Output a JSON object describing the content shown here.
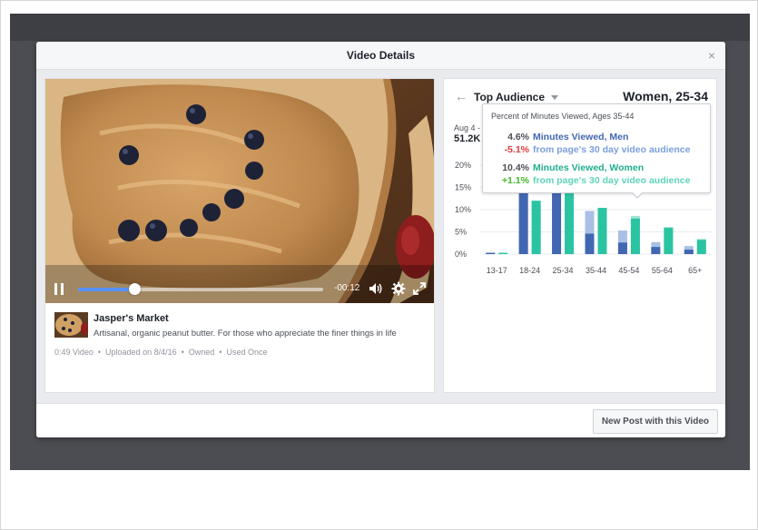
{
  "modal": {
    "title": "Video Details",
    "close_glyph": "×",
    "footer_button": "New Post with this Video"
  },
  "video": {
    "time_remaining": "-00:12",
    "progress": 0.23
  },
  "page": {
    "name": "Jasper's Market",
    "description": "Artisanal, organic peanut butter. For those who appreciate the finer things in life",
    "meta": [
      "0:49 Video",
      "Uploaded on 8/4/16",
      "Owned",
      "Used Once"
    ]
  },
  "audience": {
    "title": "Top Audience",
    "segment": "Women, 25-34",
    "date_label": "Aug 4 -",
    "count": "51.2K"
  },
  "tooltip": {
    "heading": "Percent of Minutes Viewed, Ages 35-44",
    "men_value": "4.6%",
    "men_label": "Minutes Viewed, Men",
    "men_diff": "-5.1%",
    "men_diff_label": "from page's 30 day video audience",
    "women_value": "10.4%",
    "women_label": "Minutes Viewed, Women",
    "women_diff": "+1.1%",
    "women_diff_label": "from page's 30 day video audience"
  },
  "colors": {
    "men": "#4267b2",
    "men_light": "#a9bfe6",
    "women": "#2bc4a3",
    "women_light": "#9fe6d4",
    "negative": "#e0393e",
    "positive": "#42b72a"
  },
  "chart_data": {
    "type": "bar",
    "categories": [
      "13-17",
      "18-24",
      "25-34",
      "35-44",
      "45-54",
      "55-64",
      "65+"
    ],
    "y_ticks": [
      "0%",
      "5%",
      "10%",
      "15%",
      "20%"
    ],
    "ylim": [
      0,
      20
    ],
    "series": [
      {
        "name": "Minutes Viewed, Men",
        "page_baseline": [
          0.3,
          20,
          20,
          9.7,
          5.3,
          2.7,
          1.8
        ],
        "values": [
          0.3,
          20,
          20,
          4.6,
          2.6,
          1.6,
          1.0
        ]
      },
      {
        "name": "Minutes Viewed, Women",
        "page_baseline": [
          0.3,
          12,
          20,
          9.3,
          8.6,
          6.1,
          3.4
        ],
        "values": [
          0.3,
          12,
          20,
          10.4,
          8.0,
          5.9,
          3.2
        ]
      }
    ]
  }
}
